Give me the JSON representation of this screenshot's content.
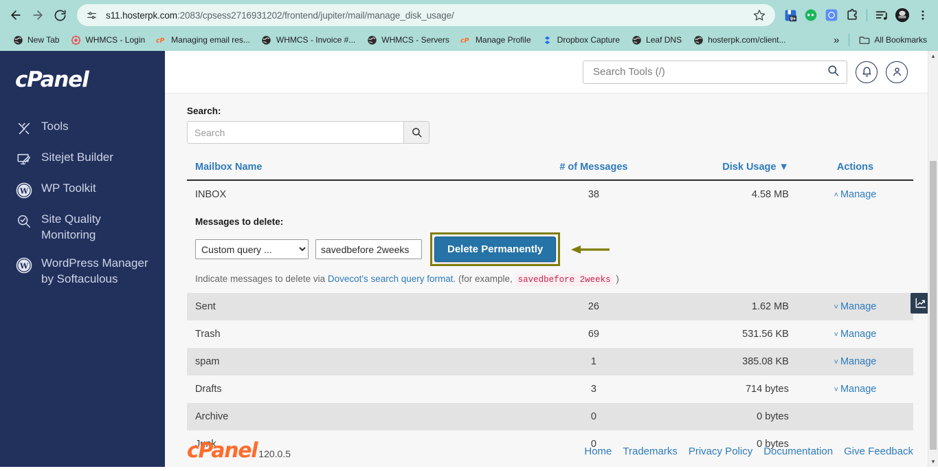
{
  "browser": {
    "nav": {
      "back_icon": "back-arrow-icon",
      "forward_icon": "forward-arrow-icon",
      "reload_icon": "reload-icon"
    },
    "omnibox": {
      "site_info_icon": "site-settings-icon",
      "url_host": "s11.hosterpk.com",
      "url_path": ":2083/cpsess2716931202/frontend/jupiter/mail/manage_disk_usage/",
      "bookmark_icon": "star-icon"
    },
    "toolbar_extensions": [
      {
        "name": "save-to-drive-extension-icon",
        "badge": "9+"
      },
      {
        "name": "chat-bubble-extension-icon",
        "badge": ""
      },
      {
        "name": "openai-extension-icon",
        "badge": ""
      },
      {
        "name": "puzzle-extensions-icon",
        "badge": ""
      },
      {
        "name": "reading-list-icon",
        "badge": ""
      },
      {
        "name": "profile-avatar-icon",
        "badge": ""
      },
      {
        "name": "chrome-menu-icon",
        "badge": ""
      }
    ],
    "bookmarks": [
      {
        "label": "New Tab",
        "icon": "globe-icon"
      },
      {
        "label": "WHMCS - Login",
        "icon": "whmcs-icon"
      },
      {
        "label": "Managing email res...",
        "icon": "cpanel-icon"
      },
      {
        "label": "WHMCS - Invoice #...",
        "icon": "globe-icon"
      },
      {
        "label": "WHMCS - Servers",
        "icon": "globe-icon"
      },
      {
        "label": "Manage Profile",
        "icon": "cpanel-icon"
      },
      {
        "label": "Dropbox Capture",
        "icon": "dropbox-icon"
      },
      {
        "label": "Leaf DNS",
        "icon": "globe-icon"
      },
      {
        "label": "hosterpk.com/client...",
        "icon": "globe-icon"
      }
    ],
    "bookmarks_overflow_label": "»",
    "all_bookmarks_label": "All Bookmarks",
    "all_bookmarks_icon": "folder-icon"
  },
  "sidebar": {
    "logo_text": "cPanel",
    "items": [
      {
        "label": "Tools",
        "icon": "tools-icon"
      },
      {
        "label": "Sitejet Builder",
        "icon": "monitor-pen-icon"
      },
      {
        "label": "WP Toolkit",
        "icon": "wordpress-icon"
      },
      {
        "label": "Site Quality Monitoring",
        "icon": "magnifier-check-icon"
      },
      {
        "label": "WordPress Manager by Softaculous",
        "icon": "wordpress-icon"
      }
    ]
  },
  "header": {
    "search_placeholder": "Search Tools (/)",
    "search_value": "",
    "search_icon": "search-icon",
    "notifications_icon": "bell-icon",
    "account_icon": "user-icon"
  },
  "content": {
    "search_label": "Search:",
    "search_placeholder": "Search",
    "search_value": "",
    "search_button_icon": "search-icon",
    "table": {
      "headers": {
        "name": "Mailbox Name",
        "messages": "# of Messages",
        "disk": "Disk Usage ▼",
        "actions": "Actions"
      },
      "rows": [
        {
          "name": "INBOX",
          "messages": "38",
          "disk": "4.58 MB",
          "action": "Manage",
          "caret": "˄",
          "expanded": true,
          "shaded": false
        },
        {
          "name": "Sent",
          "messages": "26",
          "disk": "1.62 MB",
          "action": "Manage",
          "caret": "˅",
          "expanded": false,
          "shaded": true
        },
        {
          "name": "Trash",
          "messages": "69",
          "disk": "531.56 KB",
          "action": "Manage",
          "caret": "˅",
          "expanded": false,
          "shaded": false
        },
        {
          "name": "spam",
          "messages": "1",
          "disk": "385.08 KB",
          "action": "Manage",
          "caret": "˅",
          "expanded": false,
          "shaded": true
        },
        {
          "name": "Drafts",
          "messages": "3",
          "disk": "714 bytes",
          "action": "Manage",
          "caret": "˅",
          "expanded": false,
          "shaded": false
        },
        {
          "name": "Archive",
          "messages": "0",
          "disk": "0 bytes",
          "action": "",
          "caret": "",
          "expanded": false,
          "shaded": true
        },
        {
          "name": "Junk",
          "messages": "0",
          "disk": "0 bytes",
          "action": "",
          "caret": "",
          "expanded": false,
          "shaded": false
        }
      ]
    },
    "delete_panel": {
      "label": "Messages to delete:",
      "select_value": "Custom query ...",
      "select_options": [
        "Custom query ..."
      ],
      "query_value": "savedbefore 2weeks",
      "query_placeholder": "",
      "button_label": "Delete Permanently",
      "hint_prefix": "Indicate messages to delete via ",
      "hint_link": "Dovecot's search query format",
      "hint_middle": ". (for example, ",
      "hint_code": "savedbefore 2weeks",
      "hint_suffix": " )",
      "highlight_color": "#807d08",
      "button_color": "#2573a7",
      "annotation_icon": "left-arrow-annotation"
    }
  },
  "footer": {
    "logo_text": "cPanel",
    "version": "120.0.5",
    "links": [
      "Home",
      "Trademarks",
      "Privacy Policy",
      "Documentation",
      "Give Feedback"
    ]
  },
  "floating": {
    "chart_tab_icon": "chart-icon"
  }
}
